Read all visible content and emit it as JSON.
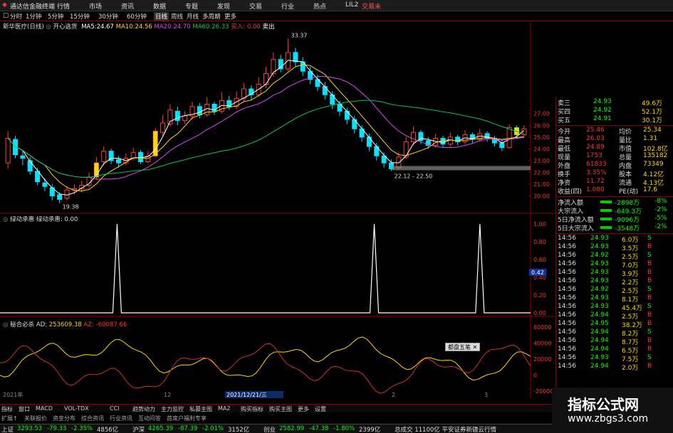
{
  "titlebar": {
    "app_name": "通达信金融终端",
    "menus": [
      "行情",
      "市场",
      "资讯",
      "数据",
      "专题",
      "发现",
      "交易",
      "行业",
      "热点",
      "LIL2"
    ],
    "right_label": "交易未"
  },
  "toolbar": {
    "periods": [
      "分时",
      "1分钟",
      "5分钟",
      "15分钟",
      "30分钟",
      "60分钟",
      "日线",
      "周线",
      "月线",
      "多周期",
      "更多"
    ],
    "active_period": "日线"
  },
  "main_legend": {
    "stock": "新华医疗(日线)",
    "indicator": "开心选货",
    "ma5_label": "MA5:",
    "ma5": "24.67",
    "ma10_label": "MA10:",
    "ma10": "24.56",
    "ma20_label": "MA20:",
    "ma20": "24.70",
    "ma60_label": "MA60:",
    "ma60": "26.33",
    "buy_label": "买入: 0.00",
    "sell_label": "卖出"
  },
  "price_annotations": {
    "high": "33.37",
    "low": "19.38",
    "range": "22.12 - 22.50"
  },
  "price_axis": [
    "27.00",
    "26.00",
    "25.00",
    "24.00",
    "23.00",
    "22.00",
    "21.00",
    "20.00"
  ],
  "signal_panel": {
    "legend": "绿动承惠 绿动承惠: 0.00",
    "axis": [
      "1.00",
      "0.80",
      "0.60",
      "0.40",
      "0.20",
      "0.00"
    ],
    "cursor_value": "0.42",
    "peaks": [
      0.2207,
      0.7054,
      0.9045
    ]
  },
  "flow_panel": {
    "legend": "秘合必杀 AD:",
    "ad": "253609.38",
    "az_label": "AZ:",
    "az": "-60087.66",
    "axis": [
      "60000",
      "40000",
      "20000",
      "0",
      "-20000"
    ],
    "popup": "都盘五笔"
  },
  "date_axis": {
    "start": "2021年",
    "mid": "12",
    "cursor": "2021/12/21/三",
    "m2": "2",
    "m3": "3"
  },
  "chart_data": {
    "type": "line",
    "ylim": [
      19,
      34
    ],
    "candles": [
      [
        22.8,
        24.9,
        25.5,
        22.3
      ],
      [
        24.8,
        23.5,
        25.1,
        23.2
      ],
      [
        23.4,
        23.2,
        23.9,
        22.6
      ],
      [
        23.0,
        22.1,
        23.3,
        21.8
      ],
      [
        22.1,
        21.2,
        22.4,
        20.9
      ],
      [
        21.1,
        20.8,
        21.5,
        20.4
      ],
      [
        20.7,
        20.0,
        21.0,
        19.6
      ],
      [
        20.1,
        19.7,
        20.3,
        19.38
      ],
      [
        19.8,
        20.5,
        20.8,
        19.6
      ],
      [
        20.5,
        20.6,
        21.0,
        20.1
      ],
      [
        20.6,
        20.9,
        21.3,
        20.3
      ],
      [
        20.9,
        21.6,
        22.0,
        20.7
      ],
      [
        21.6,
        22.8,
        23.3,
        21.4
      ],
      [
        22.9,
        23.8,
        24.2,
        22.6
      ],
      [
        23.8,
        23.0,
        24.0,
        22.7
      ],
      [
        23.1,
        22.8,
        23.4,
        22.4
      ],
      [
        22.8,
        23.2,
        23.6,
        22.6
      ],
      [
        23.2,
        23.7,
        24.1,
        23.0
      ],
      [
        23.7,
        22.9,
        23.9,
        22.7
      ],
      [
        22.9,
        23.4,
        23.8,
        22.8
      ],
      [
        23.4,
        25.5,
        25.8,
        23.3
      ],
      [
        25.4,
        26.2,
        26.9,
        25.1
      ],
      [
        26.1,
        27.3,
        27.8,
        25.9
      ],
      [
        27.2,
        26.4,
        27.6,
        26.0
      ],
      [
        26.4,
        26.8,
        27.2,
        26.1
      ],
      [
        26.8,
        27.6,
        28.0,
        26.5
      ],
      [
        27.6,
        26.9,
        27.9,
        26.6
      ],
      [
        26.9,
        27.8,
        28.4,
        26.7
      ],
      [
        27.8,
        27.2,
        28.0,
        26.9
      ],
      [
        27.2,
        28.1,
        28.8,
        27.0
      ],
      [
        28.1,
        27.6,
        28.5,
        27.3
      ],
      [
        27.6,
        28.3,
        28.9,
        27.4
      ],
      [
        28.3,
        29.1,
        29.6,
        28.0
      ],
      [
        29.1,
        28.6,
        29.4,
        28.2
      ],
      [
        28.6,
        29.5,
        30.1,
        28.4
      ],
      [
        29.5,
        30.4,
        31.0,
        29.2
      ],
      [
        30.4,
        31.6,
        32.2,
        30.1
      ],
      [
        31.6,
        30.8,
        32.0,
        30.5
      ],
      [
        30.8,
        32.2,
        33.37,
        30.6
      ],
      [
        32.2,
        31.4,
        32.6,
        31.0
      ],
      [
        31.4,
        30.6,
        31.8,
        30.2
      ],
      [
        30.6,
        29.9,
        31.0,
        29.5
      ],
      [
        29.9,
        29.3,
        30.3,
        28.9
      ],
      [
        29.3,
        28.6,
        29.7,
        28.2
      ],
      [
        28.6,
        27.8,
        28.9,
        27.4
      ],
      [
        27.8,
        27.2,
        28.1,
        26.8
      ],
      [
        27.2,
        26.5,
        27.5,
        26.1
      ],
      [
        26.5,
        25.7,
        26.8,
        25.3
      ],
      [
        25.7,
        25.0,
        26.0,
        24.6
      ],
      [
        25.0,
        24.2,
        25.3,
        23.8
      ],
      [
        24.2,
        23.4,
        24.5,
        23.0
      ],
      [
        23.4,
        22.8,
        23.7,
        22.4
      ],
      [
        22.8,
        22.3,
        23.1,
        22.12
      ],
      [
        22.4,
        23.3,
        23.7,
        22.2
      ],
      [
        23.3,
        24.6,
        25.0,
        23.1
      ],
      [
        24.6,
        25.4,
        25.9,
        24.3
      ],
      [
        25.4,
        24.7,
        25.6,
        24.4
      ],
      [
        24.7,
        24.3,
        25.0,
        24.0
      ],
      [
        24.3,
        24.9,
        25.3,
        24.1
      ],
      [
        24.9,
        24.4,
        25.1,
        24.1
      ],
      [
        24.4,
        25.0,
        25.4,
        24.2
      ],
      [
        25.0,
        24.6,
        25.2,
        24.3
      ],
      [
        24.6,
        25.2,
        25.6,
        24.4
      ],
      [
        25.2,
        24.8,
        25.4,
        24.5
      ],
      [
        24.8,
        25.3,
        25.7,
        24.6
      ],
      [
        25.3,
        24.9,
        25.5,
        24.6
      ],
      [
        24.9,
        24.5,
        25.1,
        24.2
      ],
      [
        24.5,
        24.1,
        24.7,
        23.8
      ],
      [
        24.1,
        25.8,
        26.1,
        24.0
      ],
      [
        25.8,
        25.2,
        26.0,
        24.9
      ],
      [
        25.2,
        25.7,
        26.0,
        25.0
      ]
    ]
  },
  "quote_panel": {
    "order_book": [
      {
        "label": "卖三",
        "price": "24.93",
        "vol": "49.6万"
      },
      {
        "label": "买四",
        "price": "24.92",
        "vol": "52.1万"
      },
      {
        "label": "买五",
        "price": "24.91",
        "vol": "30.1万"
      }
    ],
    "stats": [
      {
        "l1": "今开",
        "v1": "25.46",
        "l2": "均价",
        "v2": "25.34"
      },
      {
        "l1": "最高",
        "v1": "26.03",
        "l2": "量比",
        "v2": "1.31"
      },
      {
        "l1": "最低",
        "v1": "24.89",
        "l2": "市值",
        "v2": "102.8亿"
      },
      {
        "l1": "现量",
        "v1": "1753",
        "l2": "总量",
        "v2": "135182"
      },
      {
        "l1": "外盘",
        "v1": "61833",
        "l2": "内盘",
        "v2": "73349"
      },
      {
        "l1": "换手",
        "v1": "3.35%",
        "l2": "股本",
        "v2": "4.12亿"
      },
      {
        "l1": "净资",
        "v1": "11.72",
        "l2": "流通",
        "v2": "4.13亿"
      },
      {
        "l1": "收益(四)",
        "v1": "1.080",
        "l2": "PE(动)",
        "v2": "17.6"
      }
    ],
    "flows": [
      {
        "label": "净流入额",
        "value": "-2898万",
        "pct": "-8%"
      },
      {
        "label": "大宗流入",
        "value": "-649.3万",
        "pct": "-2%"
      },
      {
        "label": "5日净流入额",
        "value": "-9096万",
        "pct": "-5%"
      },
      {
        "label": "5日大宗流入",
        "value": "-3548万",
        "pct": "-2%"
      }
    ],
    "ticks": [
      {
        "t": "14:56",
        "p": "24.93",
        "v": "6.0万",
        "s": "S"
      },
      {
        "t": "14:56",
        "p": "24.93",
        "v": "3.5万",
        "s": "B"
      },
      {
        "t": "14:56",
        "p": "24.92",
        "v": "2.5万",
        "s": "S"
      },
      {
        "t": "14:56",
        "p": "24.93",
        "v": "7.0万",
        "s": "B"
      },
      {
        "t": "14:56",
        "p": "24.93",
        "v": "3.9万",
        "s": "B"
      },
      {
        "t": "14:56",
        "p": "24.93",
        "v": "2.2万",
        "s": "B"
      },
      {
        "t": "14:56",
        "p": "24.92",
        "v": "2.5万",
        "s": "S"
      },
      {
        "t": "14:56",
        "p": "24.93",
        "v": "8.1万",
        "s": "B"
      },
      {
        "t": "14:56",
        "p": "24.93",
        "v": "45.4万",
        "s": "S"
      },
      {
        "t": "14:56",
        "p": "24.94",
        "v": "2.5万",
        "s": "B"
      },
      {
        "t": "14:56",
        "p": "24.95",
        "v": "38.2万",
        "s": "B"
      },
      {
        "t": "14:56",
        "p": "24.94",
        "v": "8.2万",
        "s": "S"
      },
      {
        "t": "14:56",
        "p": "24.94",
        "v": "8.7万",
        "s": "B"
      },
      {
        "t": "14:56",
        "p": "24.94",
        "v": "6.5万",
        "s": "B"
      },
      {
        "t": "14:56",
        "p": "24.93",
        "v": "7.5万",
        "s": "S"
      },
      {
        "t": "14:56",
        "p": "24.94",
        "v": "2.0万",
        "s": "B"
      }
    ]
  },
  "bottom_tabs": [
    "指标",
    "窗口",
    "MACD",
    "VOL-TDX",
    "CCI",
    "趋势动力",
    "主力监控",
    "私募主图",
    "MA2",
    "购买指标",
    "购买主图",
    "更多",
    "设置"
  ],
  "bottom_links": [
    "扩展↑",
    "关联报价",
    "资金分布",
    "综合资讯",
    "行业资讯",
    "互动问答",
    "首席户福利专享"
  ],
  "statusbar": {
    "items": [
      {
        "name": "上证",
        "v": "3293.53",
        "c": "-79.33",
        "p": "-2.35%",
        "amt": "4856亿"
      },
      {
        "name": "沪深",
        "v": "4265.39",
        "c": "-87.39",
        "p": "-2.01%",
        "amt": "3152亿"
      },
      {
        "name": "创业",
        "v": "2582.99",
        "c": "-47.38",
        "p": "-1.80%",
        "amt": "2399亿"
      }
    ],
    "extra": "总成交 11100亿 平安证券新疆云行情"
  },
  "watermark": {
    "line1": "指标公式网",
    "line2": "www.zbgs3.com"
  },
  "colors": {
    "up": "#ff3b3b",
    "down": "#00e5ff",
    "ma5": "#ffffff",
    "ma10": "#ffd700",
    "ma20": "#e040fb",
    "ma60": "#00c853"
  }
}
